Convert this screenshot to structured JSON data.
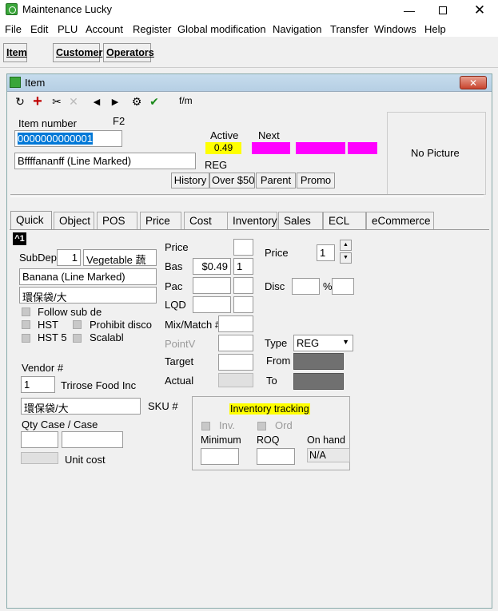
{
  "window": {
    "title": "Maintenance  Lucky",
    "min_icon": "minimize-icon",
    "max_icon": "maximize-icon",
    "close_icon": "close-icon"
  },
  "menu": [
    "File",
    "Edit",
    "PLU",
    "Account",
    "Register",
    "Global modification",
    "Navigation",
    "Transfer",
    "Windows",
    "Help"
  ],
  "toolbar_tabs": [
    "Item",
    "Customer",
    "Operators"
  ],
  "child": {
    "title": "Item",
    "toolbar_label": "f/m",
    "item_number_label": "Item number",
    "f2": "F2",
    "item_number": "0000000000001",
    "description": "Bffffananff (Line Marked)",
    "active_label": "Active",
    "next_label": "Next",
    "active_price": "0.49",
    "reg": "REG",
    "no_picture": "No Picture",
    "buttons": [
      "History",
      "Over $50",
      "Parent",
      "Promo"
    ],
    "tabs": [
      "Quick",
      "Object",
      "POS",
      "Price",
      "Cost",
      "Inventory",
      "Sales",
      "ECL",
      "eCommerce"
    ],
    "badge": "^1"
  },
  "quick": {
    "subdep_label": "SubDep",
    "subdep_value": "1",
    "subdep_name": "Vegetable 蔬",
    "desc1": "Banana (Line Marked)",
    "desc2": "環保袋/大",
    "follow_sub": "Follow sub de",
    "hst": "HST",
    "prohibit": "Prohibit disco",
    "hst5": "HST 5",
    "scalable": "Scalabl",
    "price_label": "Price",
    "bas_label": "Bas",
    "bas_price": "$0.49",
    "bas_qty": "1",
    "pac_label": "Pac",
    "lqd_label": "LQD",
    "mixmatch_label": "Mix/Match #",
    "pointv_label": "PointV",
    "target_label": "Target",
    "actual_label": "Actual",
    "price2_label": "Price",
    "price2_value": "1",
    "disc_label": "Disc",
    "pct": "%",
    "type_label": "Type",
    "type_value": "REG",
    "from_label": "From",
    "to_label": "To",
    "vendor_label": "Vendor #",
    "vendor_value": "1",
    "vendor_name": "Trirose Food Inc",
    "vendor_desc": "環保袋/大",
    "sku_label": "SKU #",
    "qty_case_label": "Qty Case / Case",
    "unit_cost_label": "Unit cost",
    "inv_title": "Inventory tracking",
    "inv_label": "Inv.",
    "ord_label": "Ord",
    "minimum_label": "Minimum",
    "roq_label": "ROQ",
    "onhand_label": "On hand",
    "onhand_value": "N/A"
  },
  "colors": {
    "highlight": "#ffff00",
    "next": "#ff00ff",
    "selection": "#0078d7",
    "dark": "#707070"
  }
}
